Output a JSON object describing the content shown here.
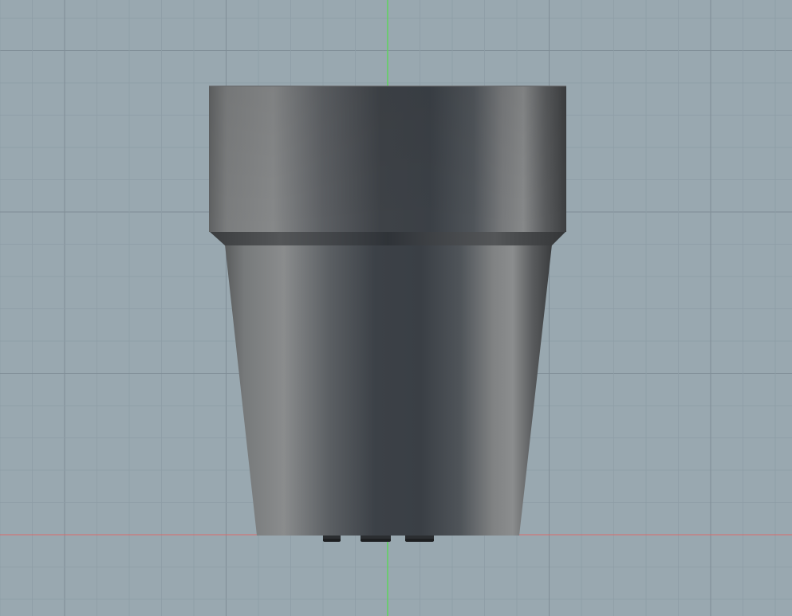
{
  "viewport": {
    "view_mode": "orthographic-front",
    "background_color": "#99a8b0",
    "grid": {
      "visible": true,
      "minor_color": "#8e9da6",
      "major_color": "#7f8d96"
    },
    "axes": {
      "x_axis_color": "#d96b6b",
      "z_axis_color": "#5dd45d"
    }
  },
  "model": {
    "name": "flower-pot",
    "material_color": "#4a4f54",
    "parts": [
      {
        "name": "rim",
        "shape": "cylinder-band"
      },
      {
        "name": "body",
        "shape": "tapered-cone"
      },
      {
        "name": "feet",
        "count": 3
      }
    ]
  }
}
